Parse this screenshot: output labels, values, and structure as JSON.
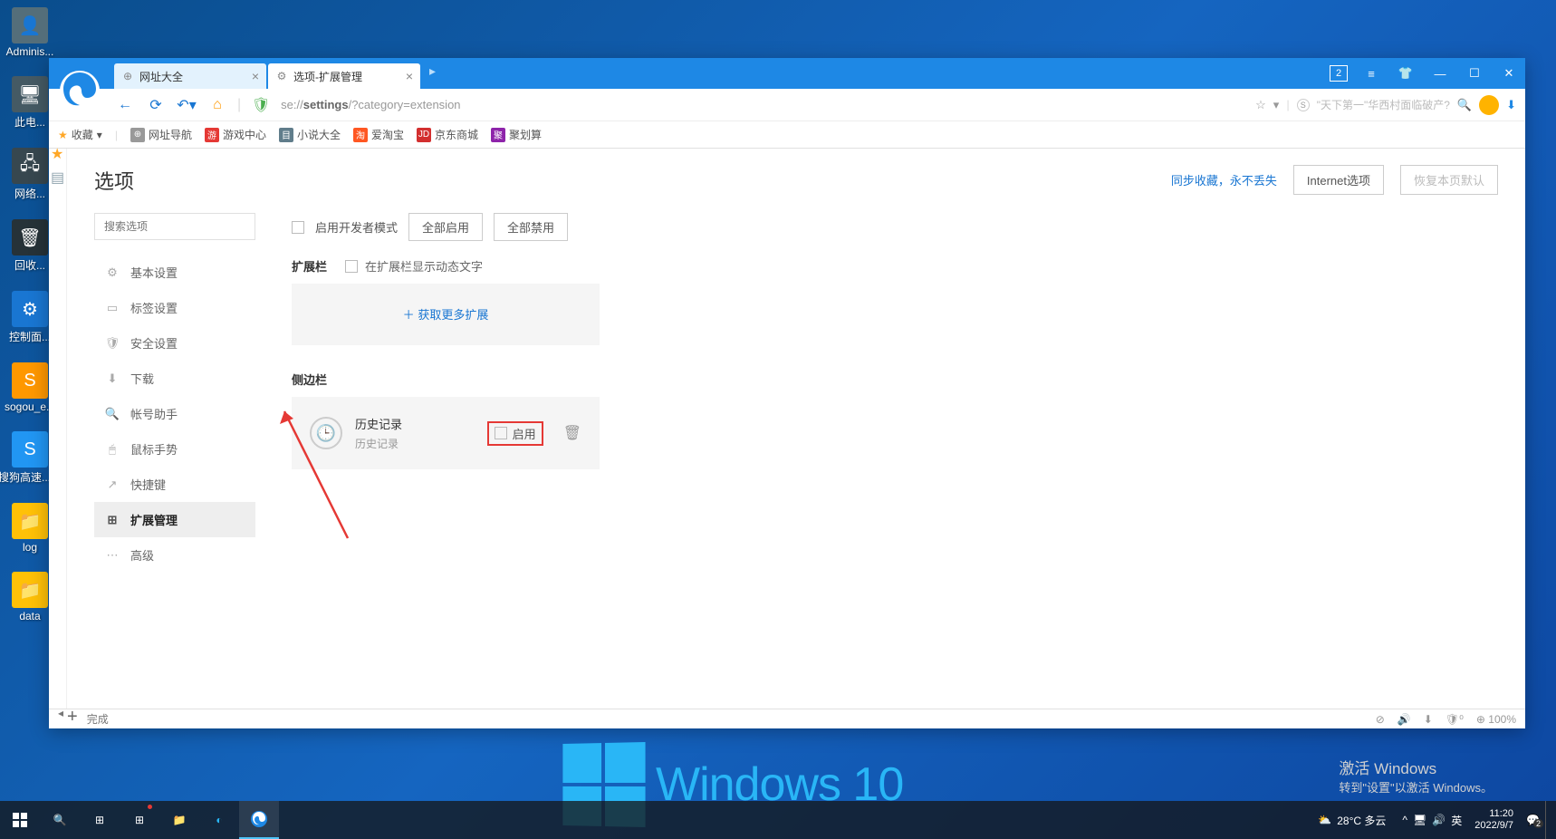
{
  "desktop": {
    "icons": [
      "Adminis...",
      "此电...",
      "网络...",
      "回收...",
      "控制面...",
      "sogou_e...",
      "搜狗高速...器",
      "log",
      "data"
    ]
  },
  "browser": {
    "tabs": [
      {
        "label": "网址大全",
        "active": false
      },
      {
        "label": "选项-扩展管理",
        "active": true
      }
    ],
    "url_prefix": "se://",
    "url_bold": "settings",
    "url_suffix": "/?category=extension",
    "search_placeholder": "\"天下第一\"华西村面临破产?",
    "window_badge": "2"
  },
  "bookmarks": {
    "fav_label": "收藏",
    "items": [
      {
        "color": "#999",
        "char": "⊕",
        "label": "网址导航"
      },
      {
        "color": "#e53935",
        "char": "游",
        "label": "游戏中心"
      },
      {
        "color": "#607d8b",
        "char": "目",
        "label": "小说大全"
      },
      {
        "color": "#ff5722",
        "char": "淘",
        "label": "爱淘宝"
      },
      {
        "color": "#d32f2f",
        "char": "JD",
        "label": "京东商城"
      },
      {
        "color": "#8e24aa",
        "char": "聚",
        "label": "聚划算"
      }
    ]
  },
  "page": {
    "title": "选项",
    "sync_link": "同步收藏，永不丢失",
    "internet_btn": "Internet选项",
    "restore_btn": "恢复本页默认",
    "search_placeholder": "搜索选项"
  },
  "menu": [
    {
      "icon": "⚙",
      "label": "基本设置"
    },
    {
      "icon": "▭",
      "label": "标签设置"
    },
    {
      "icon": "🛡",
      "label": "安全设置"
    },
    {
      "icon": "⬇",
      "label": "下载"
    },
    {
      "icon": "🔍",
      "label": "帐号助手"
    },
    {
      "icon": "🖱",
      "label": "鼠标手势"
    },
    {
      "icon": "↗",
      "label": "快捷键"
    },
    {
      "icon": "⊞",
      "label": "扩展管理",
      "active": true
    },
    {
      "icon": "⋯",
      "label": "高级"
    }
  ],
  "ext": {
    "dev_mode": "启用开发者模式",
    "enable_all": "全部启用",
    "disable_all": "全部禁用",
    "section_bar": "扩展栏",
    "show_text": "在扩展栏显示动态文字",
    "get_more": "获取更多扩展",
    "section_sidebar": "侧边栏",
    "item": {
      "name": "历史记录",
      "desc": "历史记录",
      "enable": "启用"
    }
  },
  "statusbar": {
    "done": "完成",
    "zoom": "100%"
  },
  "watermark": {
    "title": "激活 Windows",
    "sub": "转到\"设置\"以激活 Windows。",
    "logo_text": "Windows 10"
  },
  "taskbar": {
    "weather": "28°C 多云",
    "ime": "英",
    "time": "11:20",
    "date": "2022/9/7",
    "notif_badge": "2"
  }
}
